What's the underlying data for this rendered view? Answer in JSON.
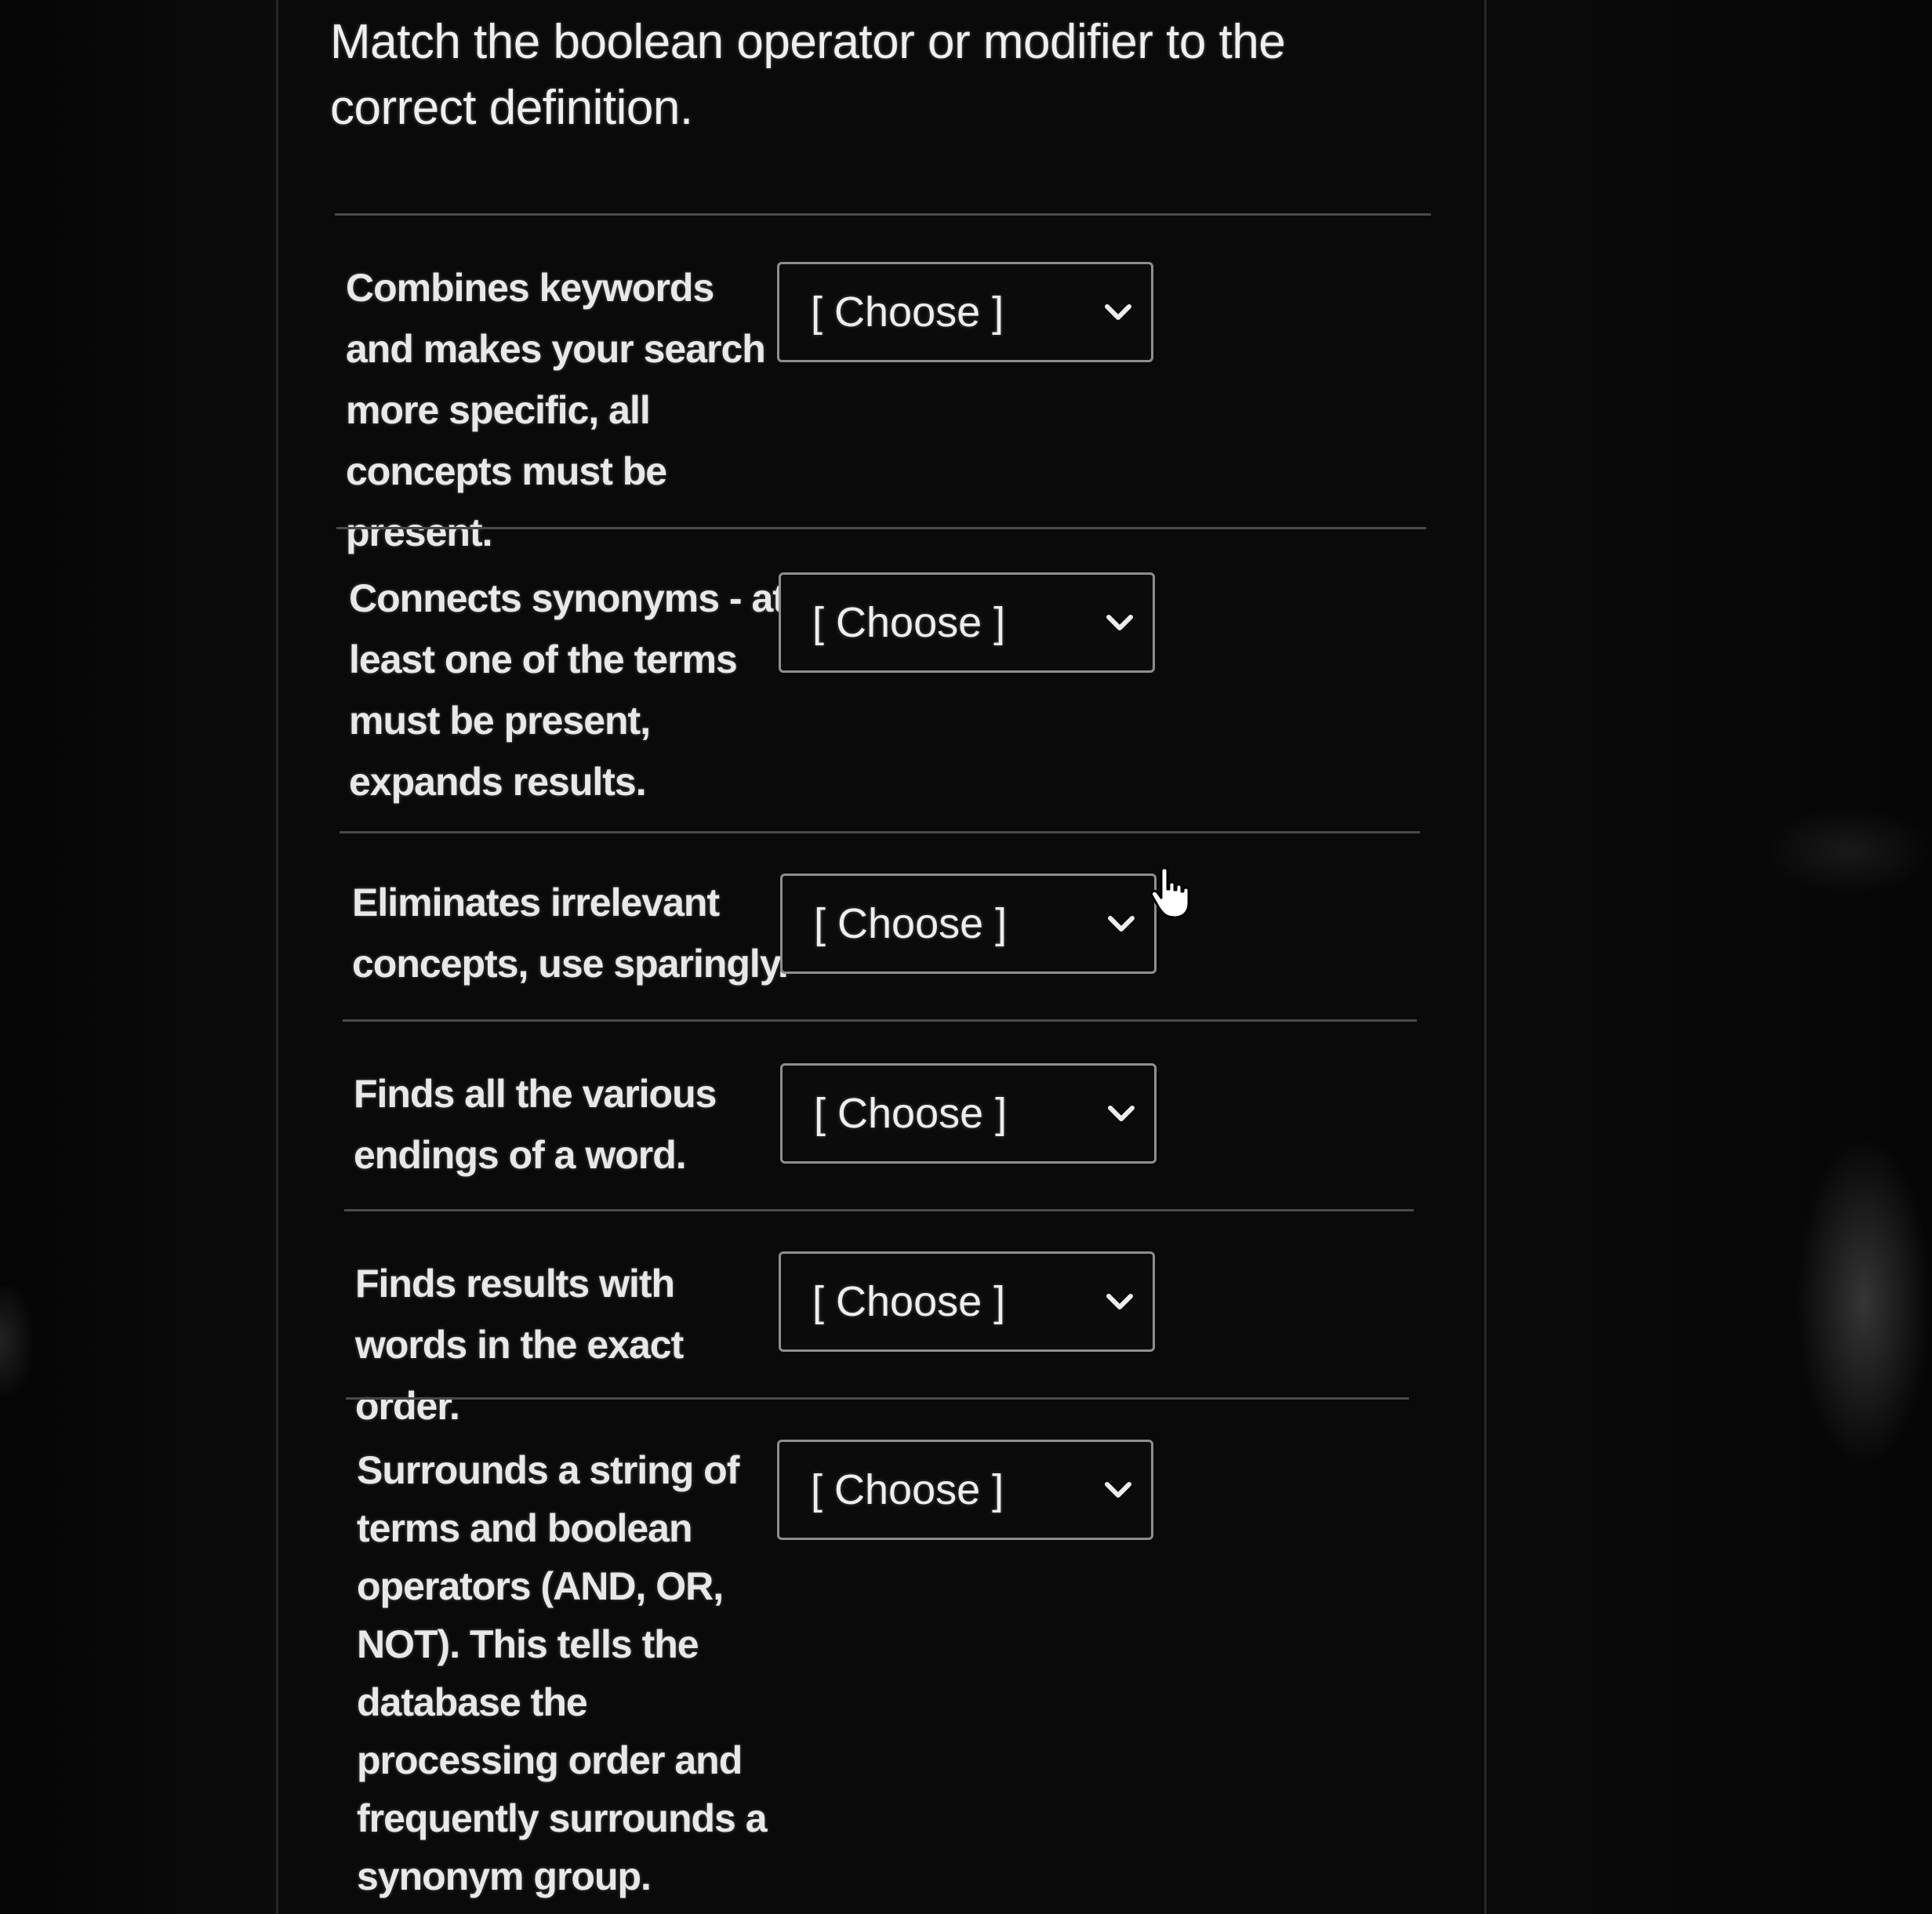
{
  "question": {
    "title": "Match the boolean operator or modifier to the correct definition."
  },
  "rows": [
    {
      "label": "Combines keywords and makes your search more specific, all concepts must be present.",
      "selected": "[ Choose ]"
    },
    {
      "label": "Connects synonyms - at least one of the terms must be present, expands results.",
      "selected": "[ Choose ]"
    },
    {
      "label": "Eliminates irrelevant concepts, use sparingly.",
      "selected": "[ Choose ]"
    },
    {
      "label": "Finds all the various endings of a word.",
      "selected": "[ Choose ]"
    },
    {
      "label": "Finds results with words in the exact order.",
      "selected": "[ Choose ]"
    },
    {
      "label": "Surrounds a string of terms and boolean operators (AND, OR, NOT). This tells the database the processing order and frequently surrounds a synonym group.",
      "selected": "[ Choose ]"
    }
  ],
  "icons": {
    "dropdown": "chevron-down-icon",
    "cursor": "hand-pointer-icon"
  },
  "colors": {
    "background": "#0a0a0a",
    "text": "#e8e8e8",
    "border": "#8e8e8e"
  }
}
